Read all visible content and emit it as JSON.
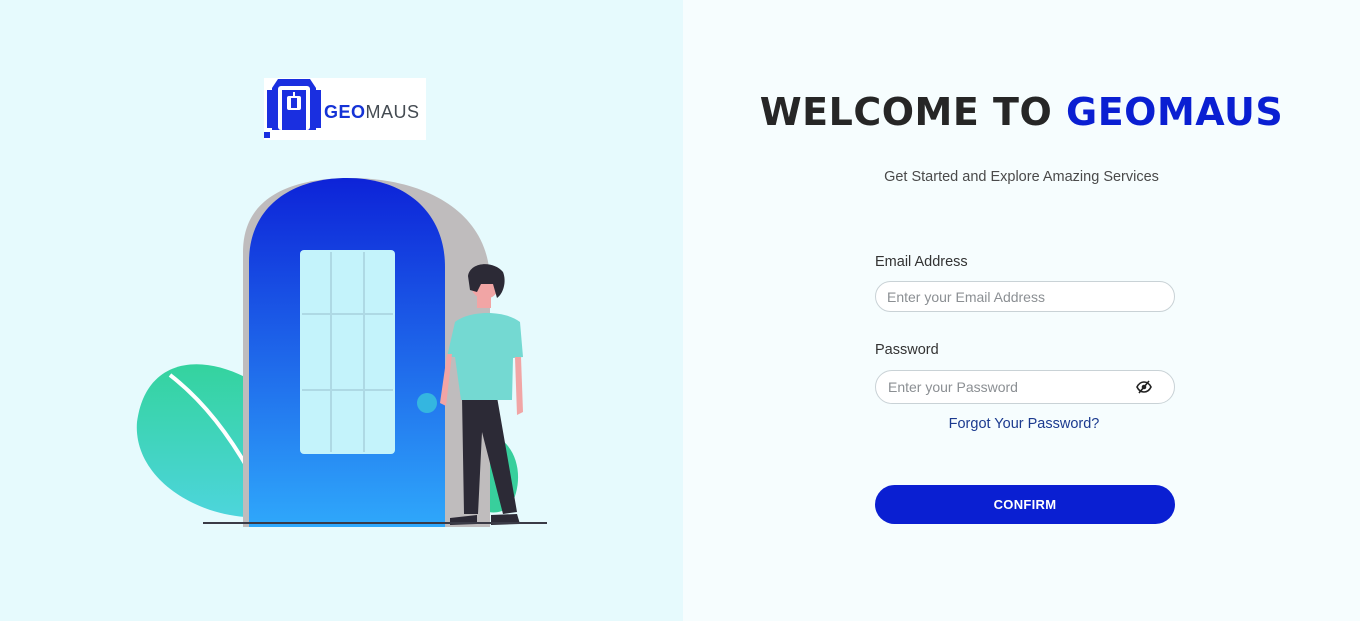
{
  "brand": {
    "logo_text_part1": "GEO",
    "logo_text_part2": "MAUS",
    "primary_color": "#0a1fd2"
  },
  "welcome": {
    "prefix": "WELCOME TO ",
    "brand": "GEOMAUS",
    "subtitle": "Get Started and Explore Amazing Services"
  },
  "form": {
    "email": {
      "label": "Email Address",
      "placeholder": "Enter your Email Address",
      "value": ""
    },
    "password": {
      "label": "Password",
      "placeholder": "Enter your Password",
      "value": "",
      "toggle_icon": "eye-slash-icon"
    },
    "forgot_label": "Forgot Your Password?",
    "confirm_label": "CONFIRM"
  },
  "illustration": {
    "description_icon": "person-at-door-illustration"
  }
}
